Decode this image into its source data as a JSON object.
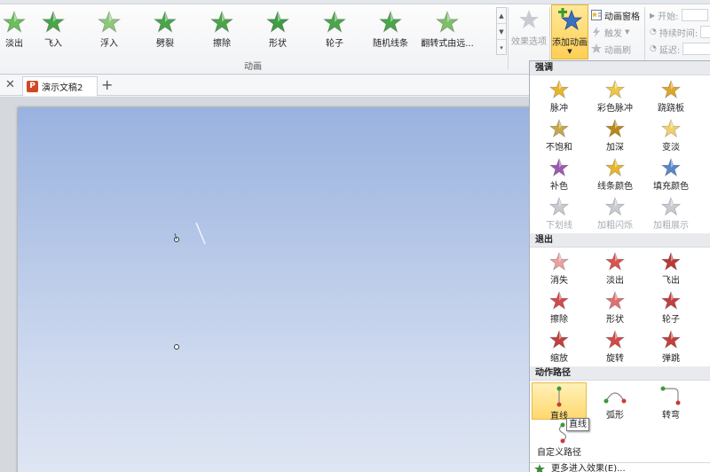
{
  "ribbon": {
    "group_label": "动画",
    "gallery": [
      {
        "label": "淡出",
        "color": "#6cbf5a"
      },
      {
        "label": "飞入",
        "color": "#4aa64a"
      },
      {
        "label": "浮入",
        "color": "#8cc97a"
      },
      {
        "label": "劈裂",
        "color": "#4aa64a"
      },
      {
        "label": "擦除",
        "color": "#4aa64a"
      },
      {
        "label": "形状",
        "color": "#3f9d45"
      },
      {
        "label": "轮子",
        "color": "#4aa64a"
      },
      {
        "label": "随机线条",
        "color": "#4aa64a"
      },
      {
        "label": "翻转式由远...",
        "color": "#7fbf6a"
      }
    ],
    "effect_options": "效果选项",
    "add_animation": "添加动画",
    "animation_pane": "动画窗格",
    "trigger": "触发",
    "animation_painter": "动画刷",
    "start": "开始:",
    "duration": "持续时间:",
    "delay": "延迟:"
  },
  "tabs": {
    "doc_name": "演示文稿2",
    "ppt_glyph": "P"
  },
  "panel": {
    "emphasis_header": "强调",
    "emphasis": [
      {
        "label": "脉冲",
        "color": "#e8b62a",
        "disabled": false
      },
      {
        "label": "彩色脉冲",
        "color": "#f0c64a",
        "disabled": false
      },
      {
        "label": "跷跷板",
        "color": "#e0a52a",
        "disabled": false
      },
      {
        "label": "不饱和",
        "color": "#c9a64a",
        "disabled": false
      },
      {
        "label": "加深",
        "color": "#b98a1a",
        "disabled": false
      },
      {
        "label": "变淡",
        "color": "#f2cf6a",
        "disabled": false
      },
      {
        "label": "补色",
        "color": "#9b5ab0",
        "disabled": false
      },
      {
        "label": "线条颜色",
        "color": "#e8b62a",
        "disabled": false
      },
      {
        "label": "填充颜色",
        "color": "#5a86c8",
        "disabled": false
      },
      {
        "label": "下划线",
        "color": "#c8ccd2",
        "disabled": true
      },
      {
        "label": "加粗闪烁",
        "color": "#c8ccd2",
        "disabled": true
      },
      {
        "label": "加粗展示",
        "color": "#c8ccd2",
        "disabled": true
      }
    ],
    "exit_header": "退出",
    "exit": [
      {
        "label": "消失",
        "color": "#e8a0a0"
      },
      {
        "label": "淡出",
        "color": "#d9534f"
      },
      {
        "label": "飞出",
        "color": "#b83a3a"
      },
      {
        "label": "擦除",
        "color": "#d24a4a"
      },
      {
        "label": "形状",
        "color": "#e07070"
      },
      {
        "label": "轮子",
        "color": "#c24040"
      },
      {
        "label": "缩放",
        "color": "#c24040"
      },
      {
        "label": "旋转",
        "color": "#d24a4a"
      },
      {
        "label": "弹跳",
        "color": "#c24040"
      }
    ],
    "paths_header": "动作路径",
    "paths": [
      {
        "label": "直线"
      },
      {
        "label": "弧形"
      },
      {
        "label": "转弯"
      },
      {
        "label": "自定义路径"
      }
    ],
    "tooltip": "直线",
    "more_effects": "更多进入效果(E)..."
  }
}
